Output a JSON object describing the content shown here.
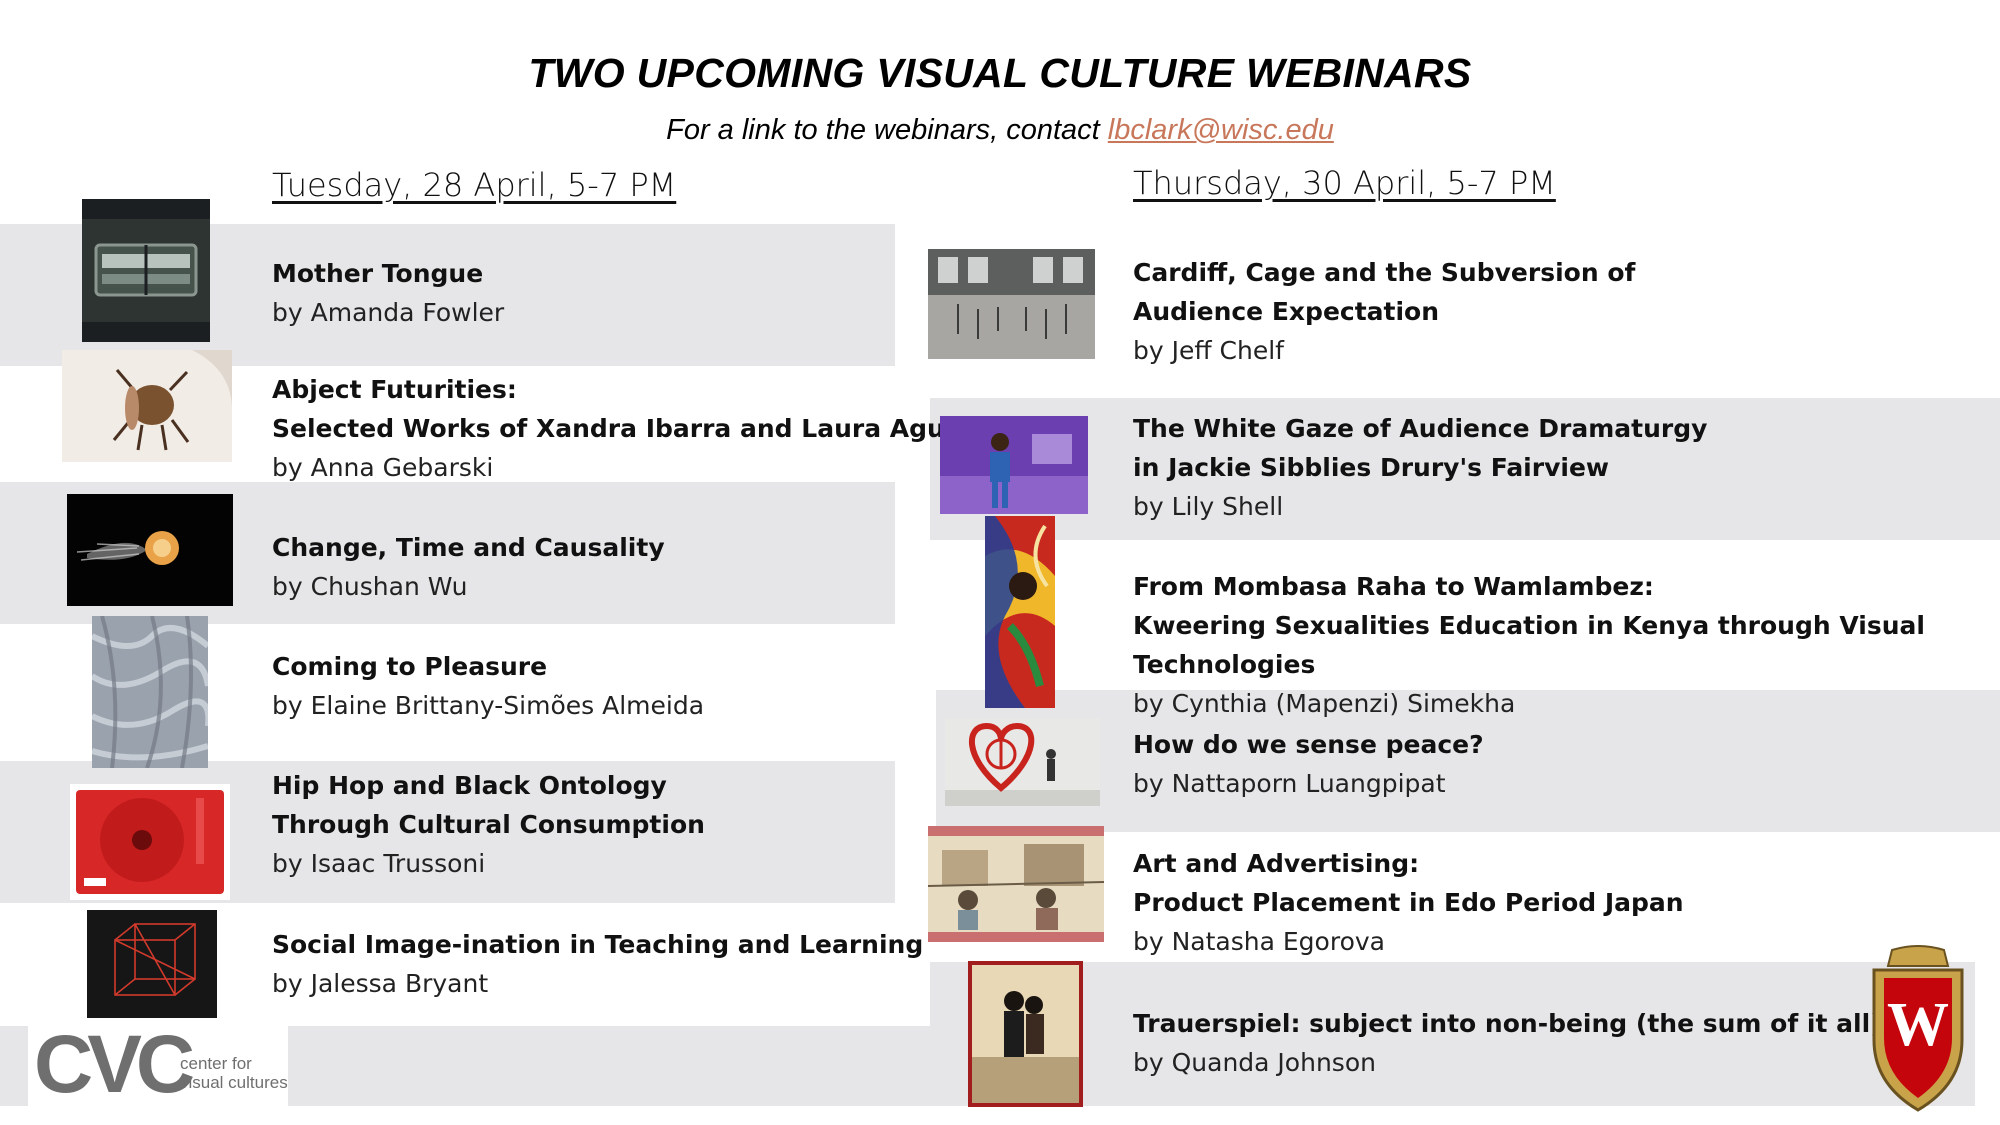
{
  "header": {
    "title": "TWO UPCOMING VISUAL CULTURE WEBINARS",
    "subtitle_prefix": "For a link to the webinars, contact ",
    "contact_email": "lbclark@wisc.edu"
  },
  "tuesday": {
    "heading": "Tuesday, 28 April, 5-7 PM",
    "talks": [
      {
        "title": "Mother Tongue",
        "author": "by Amanda Fowler"
      },
      {
        "title": "Abject Futurities:",
        "title2": "Selected Works of Xandra Ibarra and Laura Aguilar",
        "author": "by Anna Gebarski"
      },
      {
        "title": "Change, Time and Causality",
        "author": "by Chushan Wu"
      },
      {
        "title": "Coming to Pleasure",
        "author": "by Elaine Brittany-Simões Almeida"
      },
      {
        "title": "Hip Hop and Black Ontology",
        "title2": "Through Cultural Consumption",
        "author": "by Isaac Trussoni"
      },
      {
        "title": "Social Image-ination in Teaching and Learning",
        "author": "by Jalessa Bryant"
      }
    ]
  },
  "thursday": {
    "heading": "Thursday, 30 April, 5-7 PM",
    "talks": [
      {
        "title": "Cardiff, Cage and the Subversion of",
        "title2": "Audience Expectation",
        "author": "by Jeff Chelf"
      },
      {
        "title": "The White Gaze of Audience Dramaturgy",
        "title2": "in Jackie Sibblies Drury's Fairview",
        "author": "by Lily Shell"
      },
      {
        "title": "From Mombasa Raha to Wamlambez:",
        "title2": "Kweering Sexualities Education in Kenya through Visual Technologies",
        "author": "by Cynthia (Mapenzi) Simekha"
      },
      {
        "title": "How do we sense peace?",
        "author": "by Nattaporn Luangpipat"
      },
      {
        "title": "Art and Advertising:",
        "title2": "Product Placement in Edo Period Japan",
        "author": "by Natasha Egorova"
      },
      {
        "title": "Trauerspiel: subject into non-being (the sum of it all)",
        "author": "by Quanda Johnson"
      }
    ]
  },
  "logos": {
    "cvc_letters": "CVC",
    "cvc_line1": "center for",
    "cvc_line2": "visual cultures",
    "crest_letter": "W"
  },
  "colors": {
    "band": "#e6e5e7",
    "link": "#c8775a",
    "cvc": "#6f6f6f",
    "crest_red": "#c5050c",
    "crest_gold": "#c9a34a"
  }
}
